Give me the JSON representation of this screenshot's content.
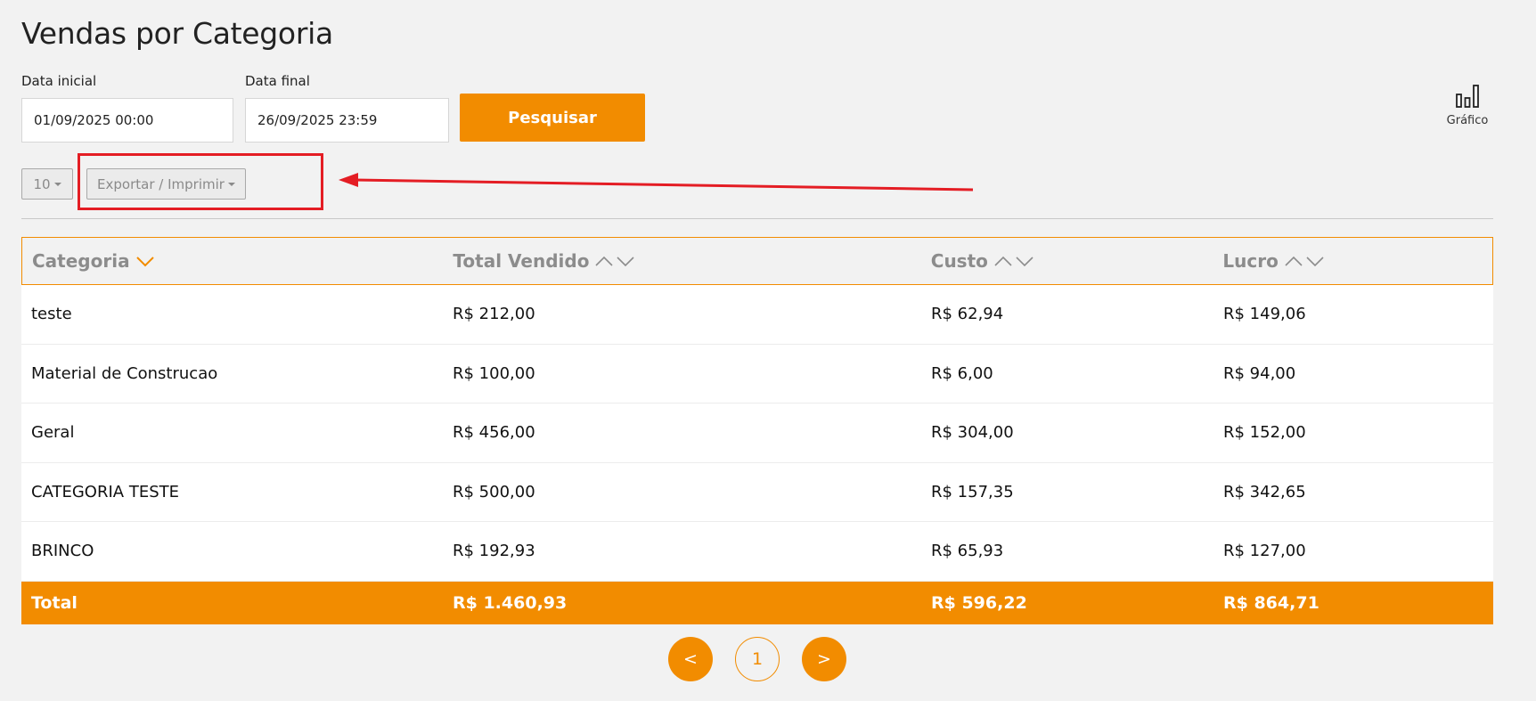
{
  "page": {
    "title": "Vendas por Categoria"
  },
  "filters": {
    "start_label": "Data inicial",
    "start_value": "01/09/2025 00:00",
    "end_label": "Data final",
    "end_value": "26/09/2025 23:59",
    "search_label": "Pesquisar"
  },
  "chart_link": {
    "label": "Gráfico",
    "icon": "bar-chart-icon"
  },
  "controls": {
    "page_size": "10",
    "export_label": "Exportar / Imprimir"
  },
  "table": {
    "columns": [
      "Categoria",
      "Total Vendido",
      "Custo",
      "Lucro"
    ],
    "rows": [
      [
        "teste",
        "R$ 212,00",
        "R$ 62,94",
        "R$ 149,06"
      ],
      [
        "Material de Construcao",
        "R$ 100,00",
        "R$ 6,00",
        "R$ 94,00"
      ],
      [
        "Geral",
        "R$ 456,00",
        "R$ 304,00",
        "R$ 152,00"
      ],
      [
        "CATEGORIA TESTE",
        "R$ 500,00",
        "R$ 157,35",
        "R$ 342,65"
      ],
      [
        "BRINCO",
        "R$ 192,93",
        "R$ 65,93",
        "R$ 127,00"
      ]
    ],
    "total": [
      "Total",
      "R$ 1.460,93",
      "R$ 596,22",
      "R$ 864,71"
    ]
  },
  "pagination": {
    "prev": "<",
    "current": "1",
    "next": ">"
  },
  "colors": {
    "accent": "#f28c00",
    "annotation": "#e41d24"
  }
}
